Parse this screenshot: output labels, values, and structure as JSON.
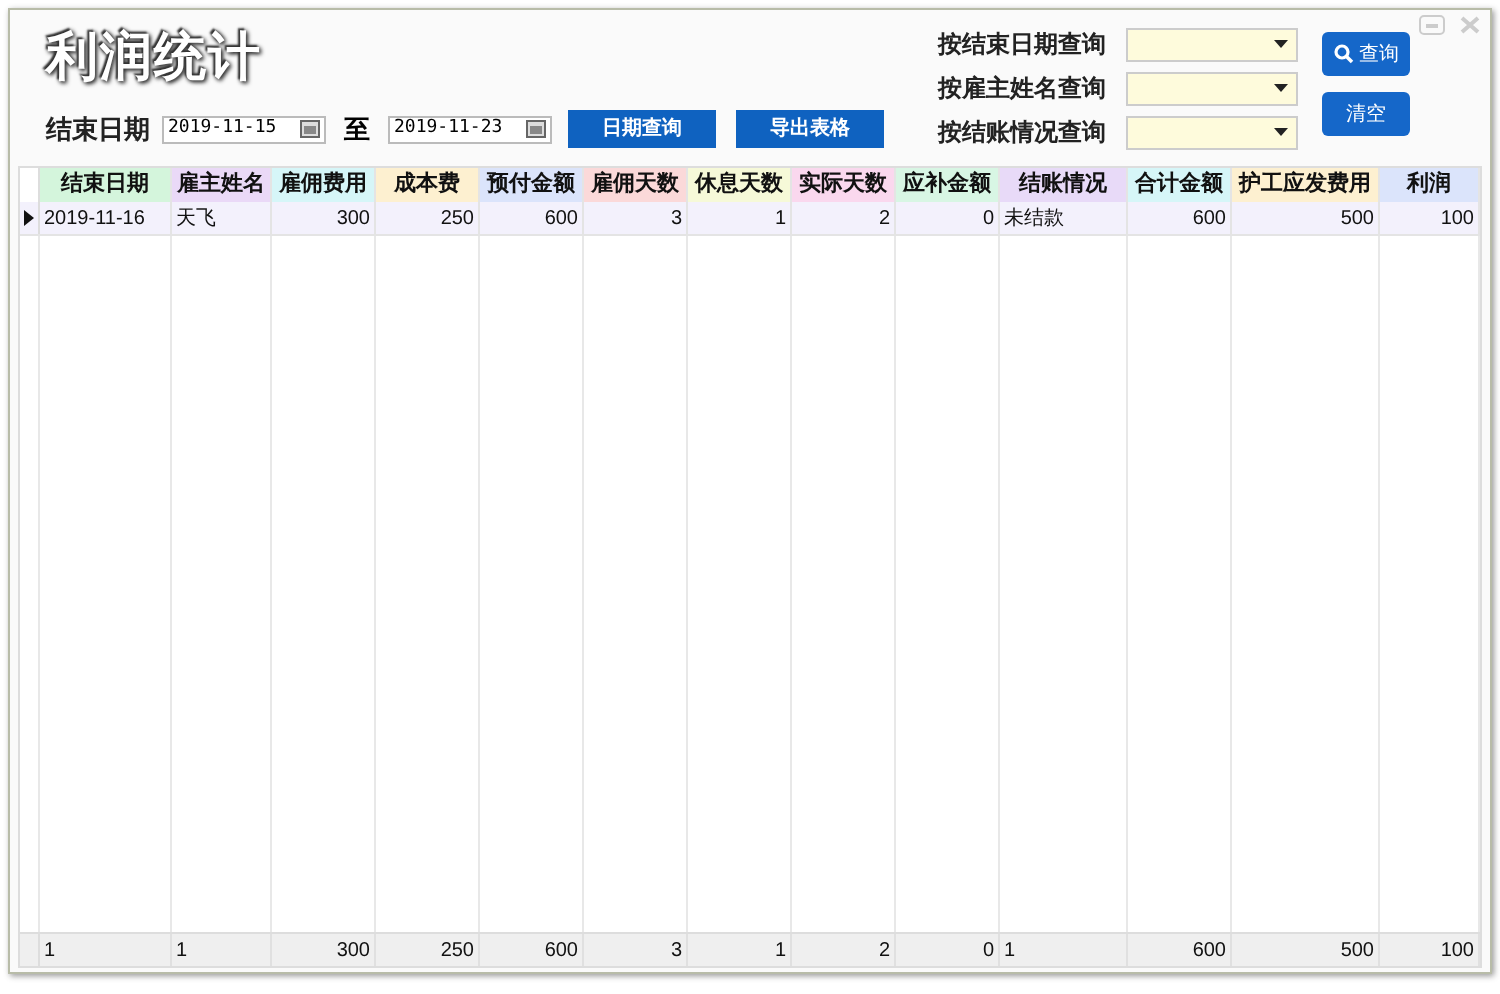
{
  "title": "利润统计",
  "date_filter": {
    "label": "结束日期",
    "from": "2019-11-15",
    "separator": "至",
    "to": "2019-11-23"
  },
  "date_buttons": [
    "日期查询",
    "导出表格"
  ],
  "queries": [
    {
      "label": "按结束日期查询"
    },
    {
      "label": "按雇主姓名查询"
    },
    {
      "label": "按结账情况查询"
    }
  ],
  "search_button": "查询",
  "clear_button": "清空",
  "table": {
    "columns": [
      {
        "title": "结束日期",
        "color": "#d4f5dc",
        "kind": "text"
      },
      {
        "title": "雇主姓名",
        "color": "#ead9f7",
        "kind": "text"
      },
      {
        "title": "雇佣费用",
        "color": "#d6f6f8",
        "kind": "number"
      },
      {
        "title": "成本费",
        "color": "#fdf0d0",
        "kind": "number"
      },
      {
        "title": "预付金额",
        "color": "#dbe4fb",
        "kind": "number"
      },
      {
        "title": "雇佣天数",
        "color": "#fbd9d9",
        "kind": "number"
      },
      {
        "title": "休息天数",
        "color": "#f6f9d8",
        "kind": "number"
      },
      {
        "title": "实际天数",
        "color": "#fad8ee",
        "kind": "number"
      },
      {
        "title": "应补金额",
        "color": "#d8f6e4",
        "kind": "number"
      },
      {
        "title": "结账情况",
        "color": "#e8daf8",
        "kind": "text"
      },
      {
        "title": "合计金额",
        "color": "#d6f6f8",
        "kind": "number"
      },
      {
        "title": "护工应发费用",
        "color": "#fdf0d0",
        "kind": "number"
      },
      {
        "title": "利润",
        "color": "#dbe4fb",
        "kind": "number"
      }
    ],
    "rows": [
      {
        "selected": true,
        "cells": [
          "2019-11-16",
          "天飞",
          "300",
          "250",
          "600",
          "3",
          "1",
          "2",
          "0",
          "未结款",
          "600",
          "500",
          "100"
        ]
      }
    ],
    "footer": [
      "1",
      "1",
      "300",
      "250",
      "600",
      "3",
      "1",
      "2",
      "0",
      "1",
      "600",
      "500",
      "100"
    ]
  }
}
